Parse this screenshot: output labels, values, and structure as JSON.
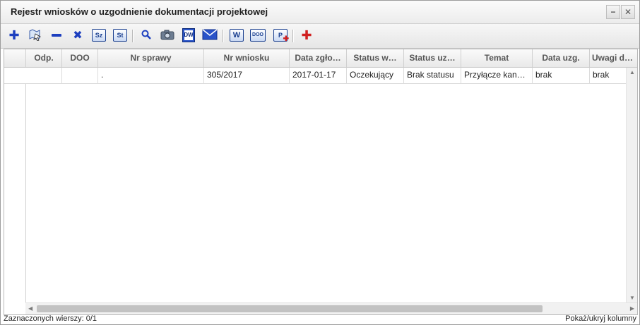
{
  "window": {
    "title": "Rejestr wniosków o uzgodnienie dokumentacji projektowej",
    "minimize_label": "−",
    "close_label": "✕"
  },
  "toolbar": {
    "buttons": [
      {
        "icon": "add-icon",
        "glyph": "✚"
      },
      {
        "icon": "map-select-icon",
        "glyph": ""
      },
      {
        "icon": "remove-icon",
        "glyph": "━"
      },
      {
        "icon": "delete-icon",
        "glyph": "✖"
      },
      {
        "icon": "sz-icon",
        "label": "Sz"
      },
      {
        "icon": "st-icon",
        "label": "St"
      },
      {
        "icon": "search-icon",
        "glyph": "⚲"
      },
      {
        "icon": "camera-icon",
        "glyph": ""
      },
      {
        "icon": "dw-icon",
        "label": "DW"
      },
      {
        "icon": "mail-icon",
        "glyph": "✉"
      },
      {
        "icon": "word-icon",
        "label": "W"
      },
      {
        "icon": "doo-icon",
        "label": "DOO"
      },
      {
        "icon": "p-plus-icon",
        "label": "P"
      },
      {
        "icon": "red-cross-icon",
        "glyph": "✚"
      }
    ],
    "colors": {
      "blue": "#1d3fbf",
      "red": "#d01f1f"
    }
  },
  "table": {
    "columns": [
      "Odp.",
      "DOO",
      "Nr sprawy",
      "Nr wniosku",
      "Data zgło…",
      "Status w…",
      "Status uz…",
      "Temat",
      "Data uzg.",
      "Uwagi do…"
    ],
    "rows": [
      [
        ".",
        "305/2017",
        "2017-01-17",
        "Oczekujący",
        "Brak statusu",
        "Przyłącze kan…",
        "brak",
        "brak"
      ]
    ]
  },
  "status": {
    "selected": "Zaznaczonych wierszy: 0/1",
    "toggle_columns": "Pokaż/ukryj kolumny"
  }
}
